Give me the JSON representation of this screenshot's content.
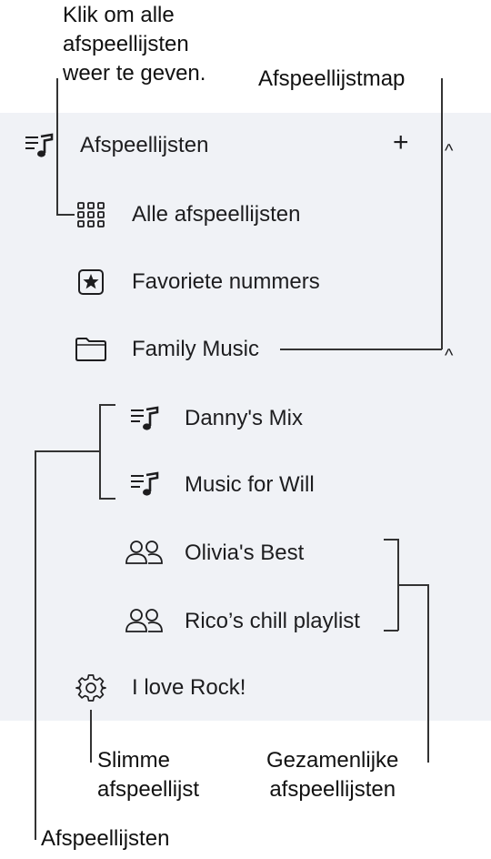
{
  "sidebar": {
    "header": {
      "label": "Afspeellijsten",
      "add": "+",
      "collapse": "^"
    },
    "items": [
      {
        "label": "Alle afspeellijsten",
        "icon": "grid-icon"
      },
      {
        "label": "Favoriete nummers",
        "icon": "star-square-icon"
      },
      {
        "label": "Family Music",
        "icon": "folder-icon",
        "collapse": "^"
      },
      {
        "label": "Danny's Mix",
        "icon": "playlist-icon"
      },
      {
        "label": "Music for Will",
        "icon": "playlist-icon"
      },
      {
        "label": "Olivia's Best",
        "icon": "people-icon"
      },
      {
        "label": "Rico’s chill playlist",
        "icon": "people-icon"
      },
      {
        "label": "I love Rock!",
        "icon": "gear-icon"
      }
    ]
  },
  "callouts": {
    "all_playlists": [
      "Klik om alle",
      "afspeellijsten",
      "weer te geven."
    ],
    "folder": "Afspeellijstmap",
    "smart": [
      "Slimme",
      "afspeellijst"
    ],
    "shared": [
      "Gezamenlijke",
      "afspeellijsten"
    ],
    "playlists": "Afspeellijsten"
  }
}
